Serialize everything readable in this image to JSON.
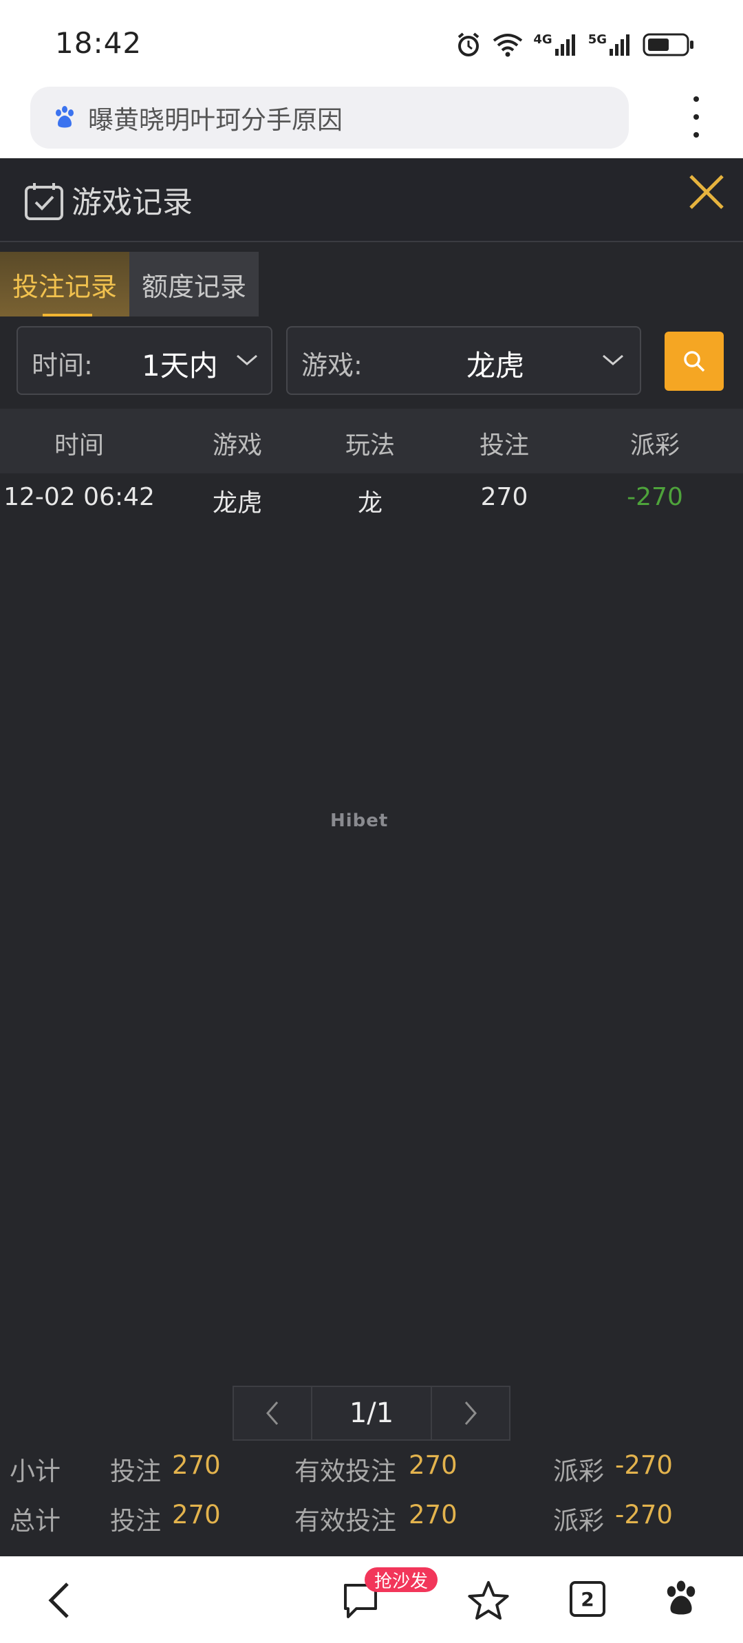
{
  "status_bar": {
    "time": "18:42",
    "net_4g": "4G",
    "net_5g": "5G"
  },
  "browser": {
    "search_text": "曝黄晓明叶珂分手原因"
  },
  "panel": {
    "title": "游戏记录"
  },
  "tabs": [
    {
      "label": "投注记录",
      "active": true
    },
    {
      "label": "额度记录",
      "active": false
    }
  ],
  "filters": {
    "time": {
      "label": "时间:",
      "value": "1天内"
    },
    "game": {
      "label": "游戏:",
      "value": "龙虎"
    }
  },
  "table": {
    "columns": [
      "时间",
      "游戏",
      "玩法",
      "投注",
      "派彩"
    ],
    "rows": [
      {
        "time": "12-02 06:42",
        "game": "龙虎",
        "play": "龙",
        "bet": "270",
        "payout": "-270"
      }
    ]
  },
  "watermark": "Hibet",
  "pagination": {
    "current": "1/1"
  },
  "summary": {
    "subtotal": {
      "label": "小计",
      "bet_label": "投注",
      "bet": "270",
      "valid_label": "有效投注",
      "valid": "270",
      "payout_label": "派彩",
      "payout": "-270"
    },
    "total": {
      "label": "总计",
      "bet_label": "投注",
      "bet": "270",
      "valid_label": "有效投注",
      "valid": "270",
      "payout_label": "派彩",
      "payout": "-270"
    }
  },
  "bottom_nav": {
    "comment_badge": "抢沙发",
    "tabs_count": "2"
  },
  "colors": {
    "accent": "#f5a623",
    "tab_active_text": "#f2c24e",
    "negative": "#4ea33b",
    "summary_value": "#e3b34d"
  }
}
